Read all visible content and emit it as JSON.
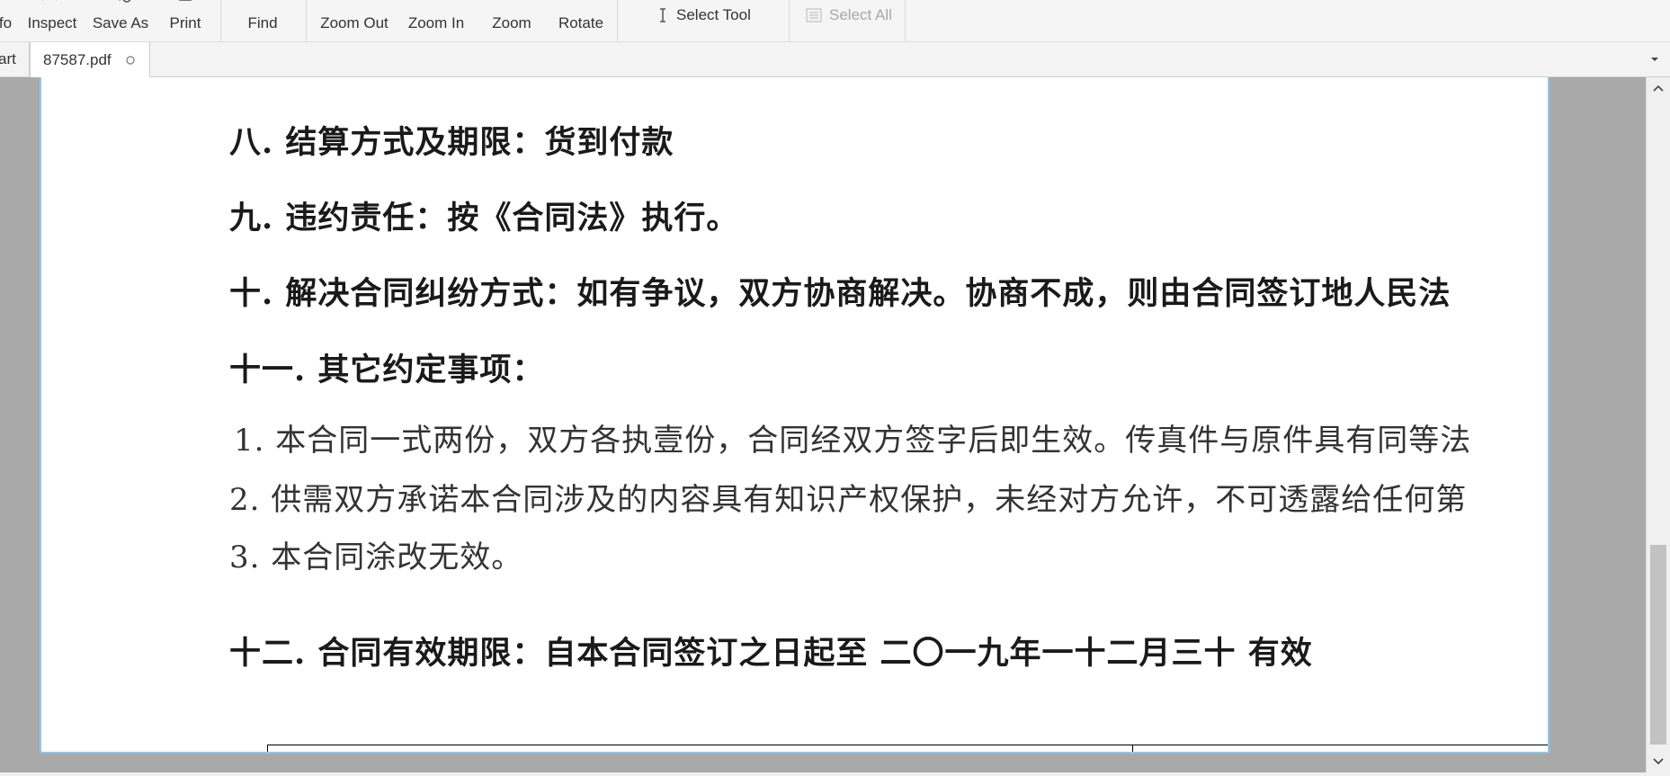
{
  "toolbar": {
    "info_partial": "fo",
    "inspect": "Inspect",
    "save_as": "Save As",
    "print": "Print",
    "find": "Find",
    "zoom_out": "Zoom Out",
    "zoom_in": "Zoom In",
    "zoom": "Zoom",
    "rotate": "Rotate",
    "select_tool": "Select Tool",
    "select_all": "Select All"
  },
  "tabs": {
    "partial_tab": "art",
    "active_tab": "87587.pdf"
  },
  "document": {
    "lines": [
      "八. 结算方式及期限：货到付款",
      "九. 违约责任：按《合同法》执行。",
      "十. 解决合同纠纷方式：如有争议，双方协商解决。协商不成，则由合同签订地人民法",
      "十一. 其它约定事项：",
      "1. 本合同一式两份，双方各执壹份，合同经双方签字后即生效。传真件与原件具有同等法",
      "2. 供需双方承诺本合同涉及的内容具有知识产权保护，未经对方允许，不可透露给任何第",
      "3. 本合同涂改无效。",
      "十二. 合同有效期限：自本合同签订之日起至 二〇一九年一十二月三十 有效"
    ]
  },
  "colors": {
    "page_border": "#8ec8ee",
    "viewer_bg": "#a9a9a9",
    "toolbar_bg": "#f5f5f5"
  }
}
